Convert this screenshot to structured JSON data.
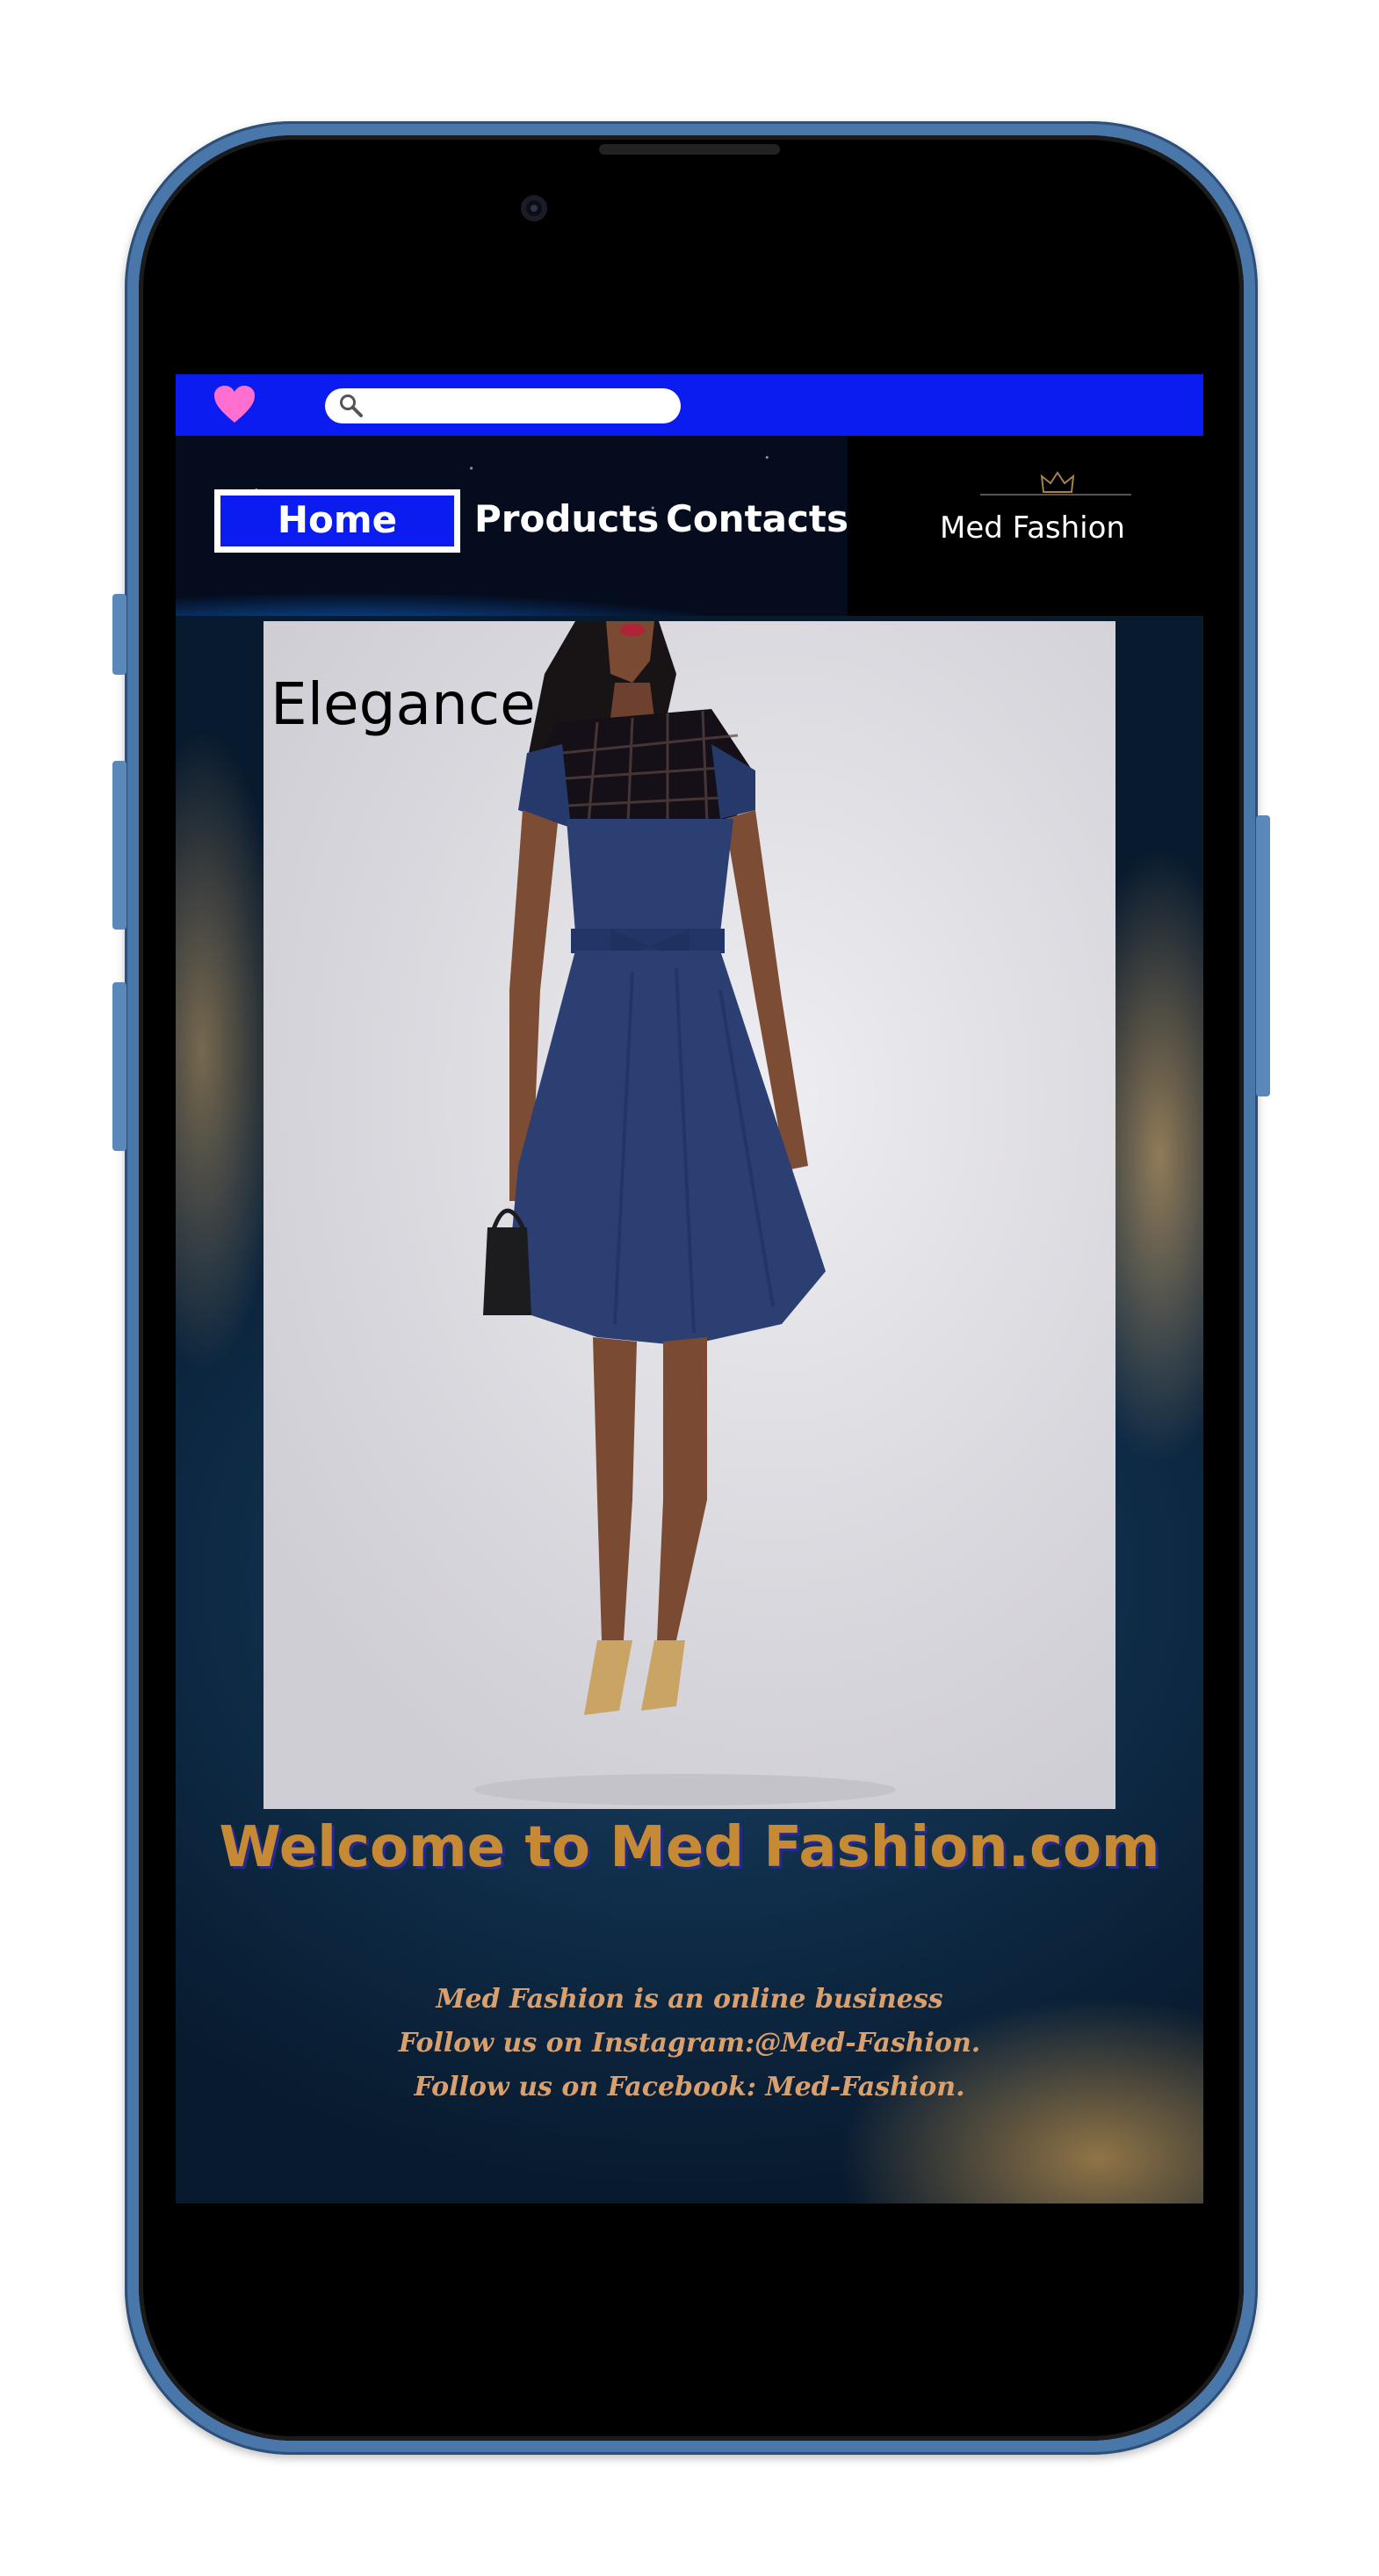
{
  "topbar": {
    "heart_icon": "heart-icon",
    "search": {
      "icon": "search-icon",
      "value": "",
      "placeholder": ""
    }
  },
  "nav": {
    "home": "Home",
    "products": "Products",
    "contacts": "Contacts"
  },
  "brand": {
    "name": "Med Fashion",
    "logo_icon": "crown-icon"
  },
  "hero": {
    "title": "Elegance"
  },
  "welcome": "Welcome to Med Fashion.com",
  "info": {
    "line1": "Med Fashion is an online business",
    "line2": "Follow us on Instagram:@Med-Fashion.",
    "line3": "Follow us on Facebook: Med-Fashion."
  },
  "colors": {
    "topbar": "#0b1cf0",
    "heart": "#ff6fd0",
    "welcome": "#c58a33",
    "welcome_shadow": "#262a8c",
    "info": "#d9a06e",
    "phone_frame": "#4a77aa"
  }
}
